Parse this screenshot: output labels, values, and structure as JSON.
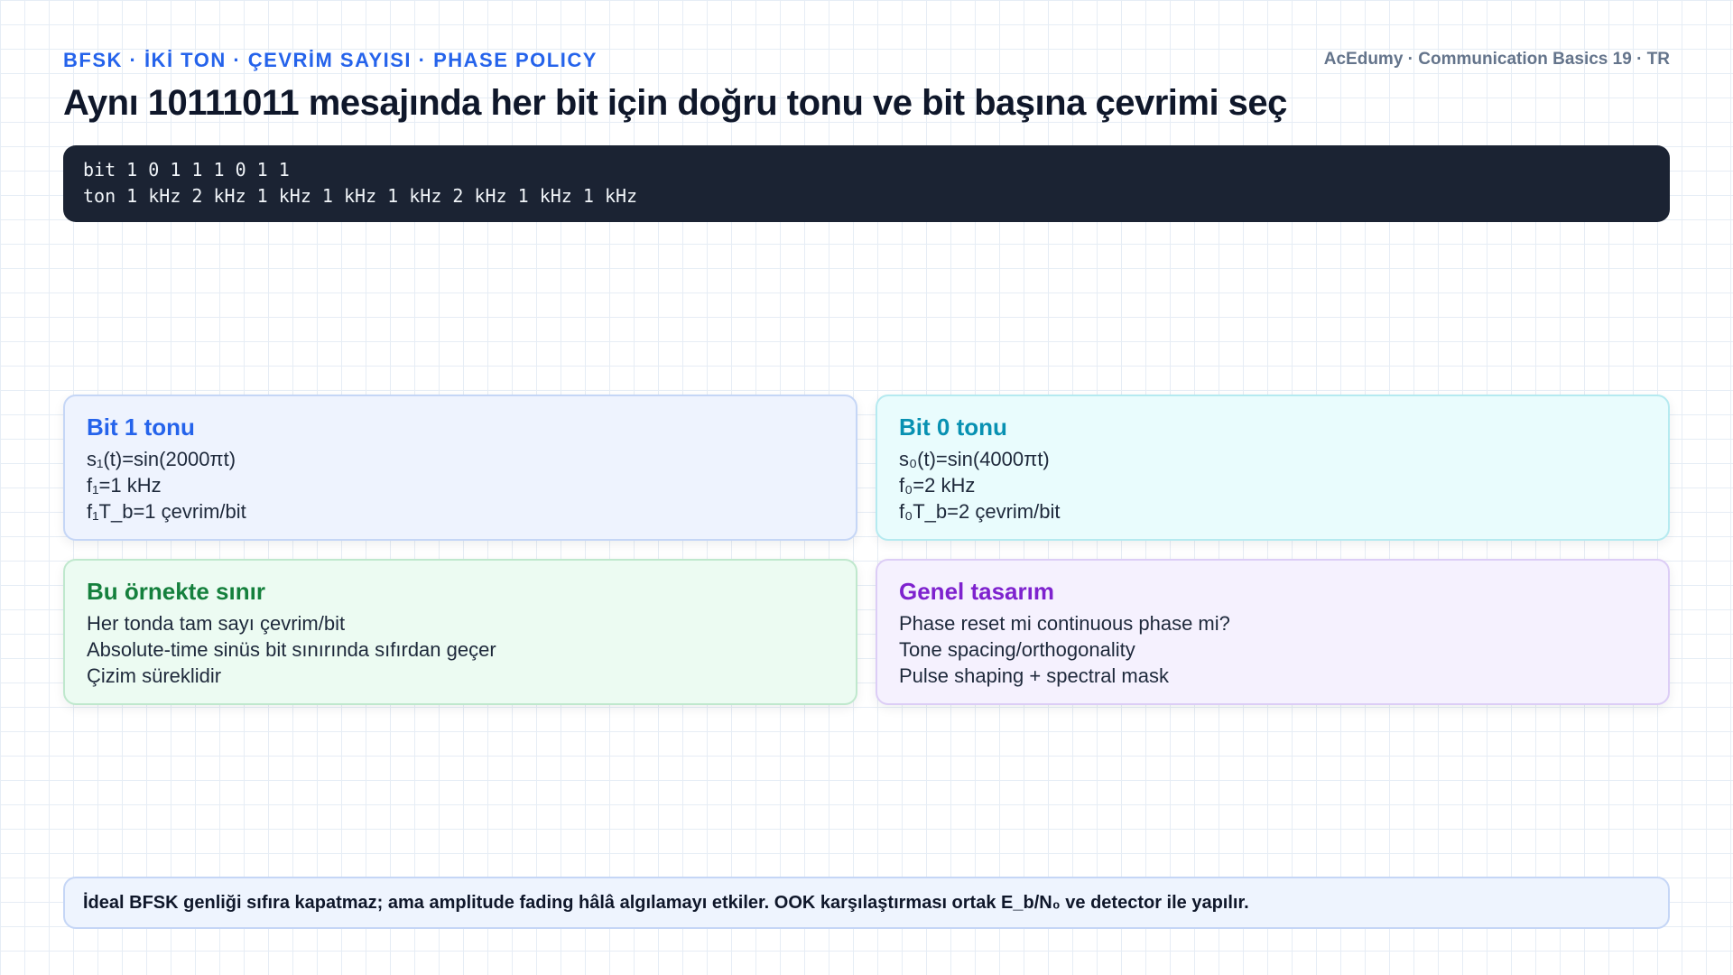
{
  "header": {
    "kicker": "BFSK · İKİ TON · ÇEVRİM SAYISI · PHASE POLICY",
    "brand": "AcEdumy · Communication Basics 19 · TR",
    "title": "Aynı 10111011 mesajında her bit için doğru tonu ve bit başına çevrimi seç"
  },
  "code": {
    "bits_line": "bit 1 0 1 1 1 0 1 1",
    "tones_line": "ton 1 kHz 2 kHz 1 kHz 1 kHz 1 kHz 2 kHz 1 kHz 1 kHz"
  },
  "cards": [
    {
      "title": "Bit 1 tonu",
      "lines": [
        "s₁(t)=sin(2000πt)",
        "f₁=1 kHz",
        "f₁T_b=1 çevrim/bit"
      ]
    },
    {
      "title": "Bit 0 tonu",
      "lines": [
        "s₀(t)=sin(4000πt)",
        "f₀=2 kHz",
        "f₀T_b=2 çevrim/bit"
      ]
    },
    {
      "title": "Bu örnekte sınır",
      "lines": [
        "Her tonda tam sayı çevrim/bit",
        "Absolute-time sinüs bit sınırında sıfırdan geçer",
        "Çizim süreklidir"
      ]
    },
    {
      "title": "Genel tasarım",
      "lines": [
        "Phase reset mi continuous phase mi?",
        "Tone spacing/orthogonality",
        "Pulse shaping + spectral mask"
      ]
    }
  ],
  "footer": {
    "note": "İdeal BFSK genliği sıfıra kapatmaz; ama amplitude fading hâlâ algılamayı etkiler. OOK karşılaştırması ortak E_b/N₀ ve detector ile yapılır."
  },
  "colors": {
    "accent_blue": "#2563eb",
    "accent_cyan": "#0891b2",
    "accent_green": "#15803d",
    "accent_purple": "#7e22ce",
    "code_background": "#1b2333"
  }
}
